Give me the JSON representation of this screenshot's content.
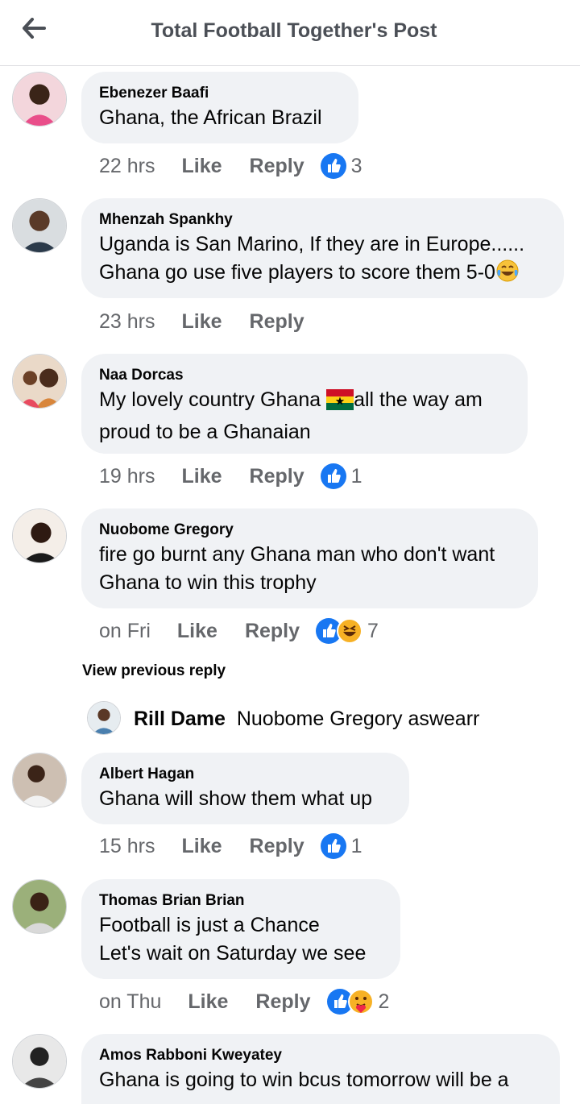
{
  "header": {
    "title": "Total Football Together's Post",
    "back_icon": "arrow-left-icon"
  },
  "comments": [
    {
      "author": "Ebenezer Baafi",
      "lines": [
        "Ghana, the African Brazil"
      ],
      "time": "22 hrs",
      "like": "Like",
      "reply": "Reply",
      "reaction_count": "3",
      "reactions": [
        "like-reaction-icon"
      ]
    },
    {
      "author": "Mhenzah Spankhy",
      "lines": [
        "Uganda is San Marino, If they are in Europe......",
        "Ghana go use five players to score them 5-0"
      ],
      "trailing_emoji": "tears-of-joy-emoji",
      "time": "23 hrs",
      "like": "Like",
      "reply": "Reply"
    },
    {
      "author": "Naa Dorcas",
      "lines_a": "My lovely  country Ghana ",
      "flag": "ghana-flag-emoji",
      "lines_b": "all the way am",
      "line2": "proud to be a Ghanaian",
      "time": "19 hrs",
      "like": "Like",
      "reply": "Reply",
      "reaction_count": "1",
      "reactions": [
        "like-reaction-icon"
      ]
    },
    {
      "author": "Nuobome Gregory",
      "lines": [
        "fire go burnt any Ghana man who don't want",
        "Ghana to win this trophy"
      ],
      "time": "on Fri",
      "like": "Like",
      "reply": "Reply",
      "reaction_count": "7",
      "reactions": [
        "like-reaction-icon",
        "haha-reaction-icon"
      ]
    },
    {
      "author": "Albert Hagan",
      "lines": [
        "Ghana will show them what up"
      ],
      "time": "15 hrs",
      "like": "Like",
      "reply": "Reply",
      "reaction_count": "1",
      "reactions": [
        "like-reaction-icon"
      ]
    },
    {
      "author": "Thomas Brian Brian",
      "lines": [
        "Football is just a Chance",
        "Let's wait on Saturday we see"
      ],
      "time": "on Thu",
      "like": "Like",
      "reply": "Reply",
      "reaction_count": "2",
      "reactions": [
        "like-reaction-icon",
        "care-reaction-icon"
      ]
    },
    {
      "author": "Amos Rabboni Kweyatey",
      "lines": [
        "Ghana is going to win bcus tomorrow will be a"
      ]
    }
  ],
  "view_previous": "View previous reply",
  "reply_preview": {
    "name": "Rill Dame",
    "text": "Nuobome Gregory aswearr"
  },
  "colors": {
    "bubble": "#f0f2f5",
    "like_blue": "#1877f2",
    "muted": "#65676b",
    "haha_yellow": "#f7b125"
  }
}
